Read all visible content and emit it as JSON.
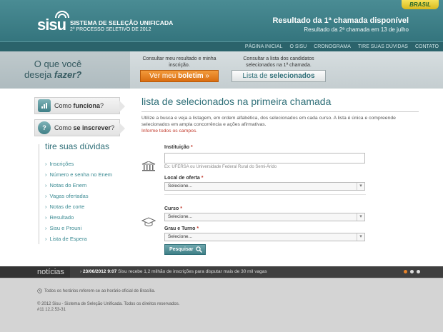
{
  "header": {
    "brasil_tab": "BRASIL",
    "logo_word": "sisu",
    "logo_line1": "SISTEMA DE SELEÇÃO UNIFICADA",
    "logo_line2": "2º PROCESSO SELETIVO DE 2012",
    "result_title": "Resultado da 1ª chamada disponível",
    "result_sub": "Resultado da 2ª chamada em 13 de julho"
  },
  "topnav": [
    "PÁGINA INICIAL",
    "O SISU",
    "CRONOGRAMA",
    "TIRE SUAS DÚVIDAS",
    "CONTATO"
  ],
  "banner": {
    "question_line1": "O que você",
    "question_line2_a": "deseja ",
    "question_line2_b": "fazer?",
    "cta1_text": "Consultar meu resultado e minha inscrição.",
    "cta1_btn_a": "Ver meu ",
    "cta1_btn_b": "boletim",
    "cta1_btn_arrow": "»",
    "cta2_text": "Consultar a lista dos candidatos selecionados na 1ª chamada.",
    "cta2_btn_a": "Lista de ",
    "cta2_btn_b": "selecionados"
  },
  "sidebar": {
    "box1_a": "Como ",
    "box1_b": "funciona",
    "box1_c": "?",
    "box2_a": "Como ",
    "box2_b": "se inscrever",
    "box2_c": "?",
    "faq_title": "tire suas dúvidas",
    "faq_items": [
      "Inscrições",
      "Número e senha no Enem",
      "Notas do Enem",
      "Vagas ofertadas",
      "Notas de corte",
      "Resultado",
      "Sisu e Prouni",
      "Lista de Espera"
    ]
  },
  "content": {
    "title": "lista de selecionados na primeira chamada",
    "description": "Utilize a busca e veja a listagem, em ordem alfabética, dos selecionados em cada curso. A lista é única e compreende selecionados em ampla concorrência e ações afirmativas.",
    "required_note": "Informe todos os campos.",
    "inst_label": "Instituição",
    "inst_hint": "Ex: UFERSA ou Universidade Federal Rural do Semi-Árido",
    "local_label": "Local de oferta",
    "local_value": "Selecione...",
    "curso_label": "Curso",
    "curso_value": "Selecione...",
    "grau_label": "Grau e Turno",
    "grau_value": "Selecione...",
    "required_mark": "*",
    "search_btn": "Pesquisar"
  },
  "news": {
    "label": "notícias",
    "arrow": "›",
    "date": "23/06/2012 9:07",
    "text": "Sisu recebe 1,2 milhão de inscrições para disputar mais de 30 mil vagas"
  },
  "footer": {
    "timezone_note": "Todos os horários referem-se ao horário oficial de Brasília.",
    "copyright": "© 2012 Sisu - Sistema de Seleção Unificada. Todos os direitos reservados.",
    "version": "#11  12.2.53-31"
  },
  "colors": {
    "teal": "#2f6f78",
    "orange": "#e8832a",
    "required": "#c0392b"
  }
}
